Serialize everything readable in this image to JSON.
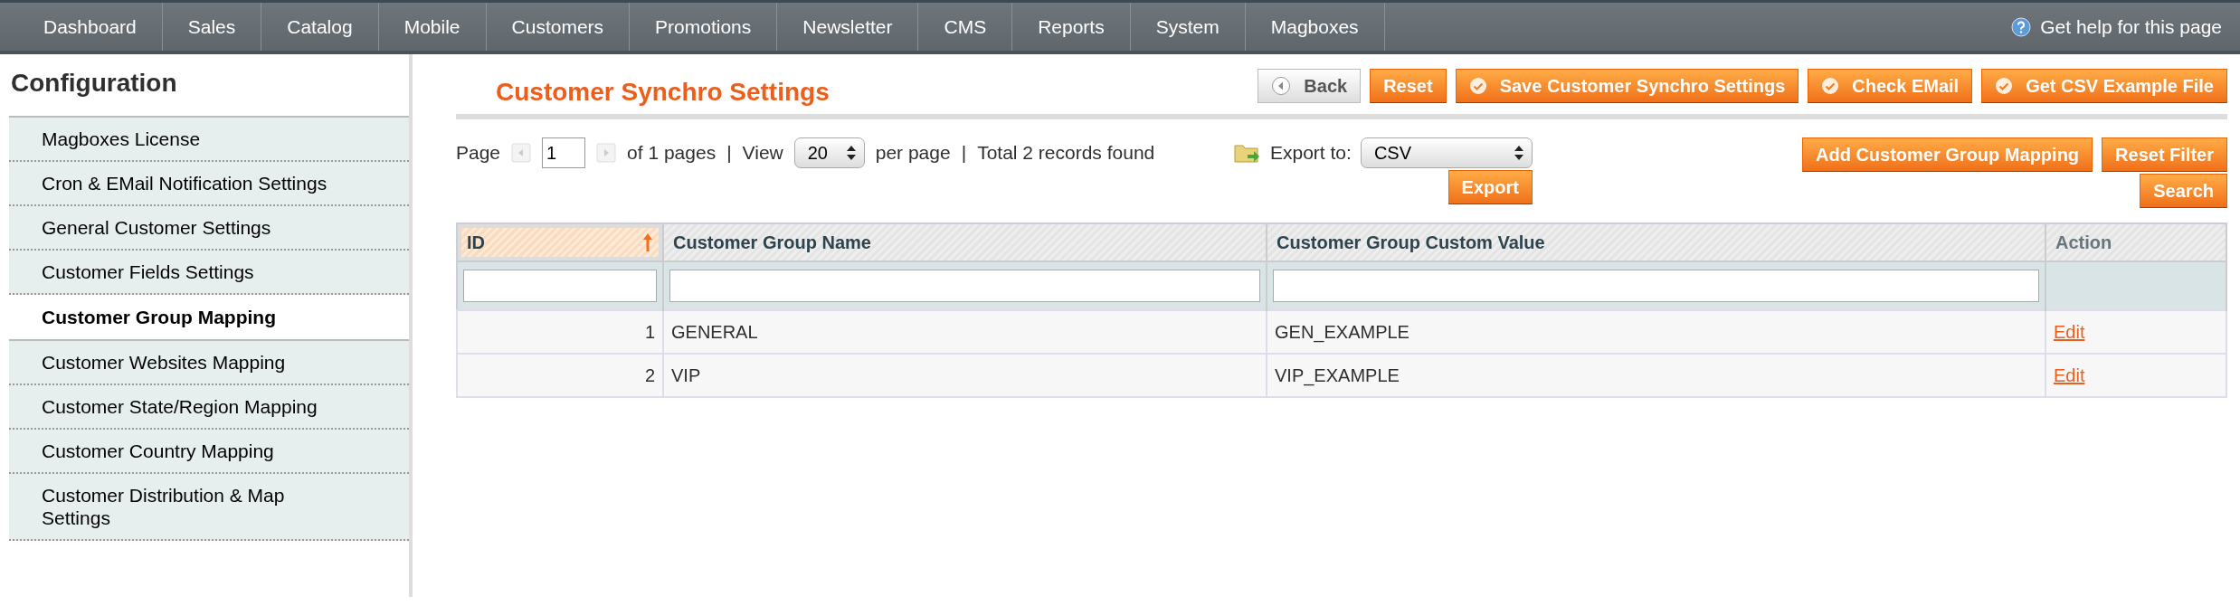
{
  "nav": {
    "items": [
      "Dashboard",
      "Sales",
      "Catalog",
      "Mobile",
      "Customers",
      "Promotions",
      "Newsletter",
      "CMS",
      "Reports",
      "System",
      "Magboxes"
    ],
    "help": "Get help for this page"
  },
  "sidebar": {
    "title": "Configuration",
    "items": [
      {
        "label": "Magboxes License",
        "selected": false
      },
      {
        "label": "Cron & EMail Notification Settings",
        "selected": false
      },
      {
        "label": "General Customer Settings",
        "selected": false
      },
      {
        "label": "Customer Fields Settings",
        "selected": false
      },
      {
        "label": "Customer Group Mapping",
        "selected": true
      },
      {
        "label": "Customer Websites Mapping",
        "selected": false
      },
      {
        "label": "Customer State/Region Mapping",
        "selected": false
      },
      {
        "label": "Customer Country Mapping",
        "selected": false
      },
      {
        "label": "Customer Distribution & Map Settings",
        "selected": false
      }
    ]
  },
  "header": {
    "title": "Customer Synchro Settings",
    "buttons": [
      {
        "label": "Back",
        "kind": "back"
      },
      {
        "label": "Reset",
        "kind": "plain"
      },
      {
        "label": "Save Customer Synchro Settings",
        "kind": "check"
      },
      {
        "label": "Check EMail",
        "kind": "check"
      },
      {
        "label": "Get CSV Example File",
        "kind": "check"
      }
    ]
  },
  "pager": {
    "page_label": "Page",
    "page": "1",
    "of_pages": "of 1 pages",
    "separator_1": "|",
    "view_label": "View",
    "per_page_value": "20",
    "per_page_label": "per page",
    "separator_2": "|",
    "total": "Total 2 records found"
  },
  "export": {
    "label": "Export to:",
    "format": "CSV",
    "button": "Export"
  },
  "grid_buttons": {
    "add": "Add Customer Group Mapping",
    "reset_filter": "Reset Filter",
    "search": "Search"
  },
  "table": {
    "columns": [
      {
        "label": "ID",
        "sorted": true,
        "filter": true
      },
      {
        "label": "Customer Group Name",
        "sorted": false,
        "filter": true
      },
      {
        "label": "Customer Group Custom Value",
        "sorted": false,
        "filter": true
      },
      {
        "label": "Action",
        "sorted": false,
        "filter": false
      }
    ],
    "rows": [
      {
        "id": "1",
        "name": "GENERAL",
        "value": "GEN_EXAMPLE",
        "action": "Edit"
      },
      {
        "id": "2",
        "name": "VIP",
        "value": "VIP_EXAMPLE",
        "action": "Edit"
      }
    ]
  }
}
